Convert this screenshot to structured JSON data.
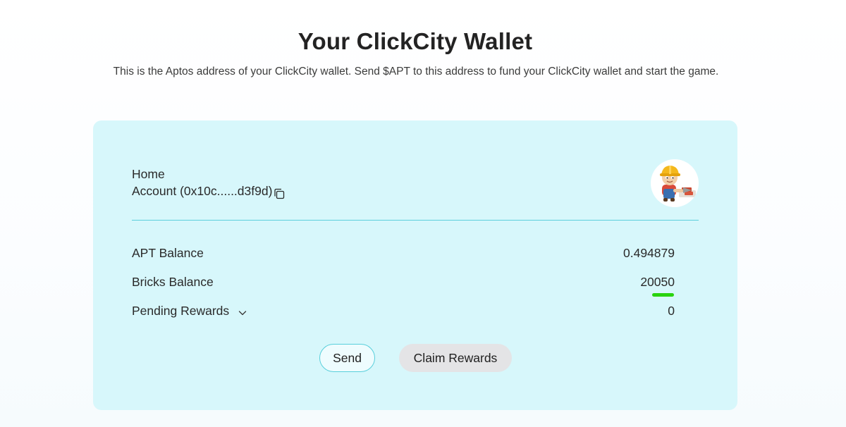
{
  "header": {
    "title": "Your ClickCity Wallet",
    "subtitle": "This is the Aptos address of your ClickCity wallet. Send $APT to this address to fund your ClickCity wallet and start the game."
  },
  "account": {
    "name": "Home",
    "label": "Account (0x10c......d3f9d)",
    "copy_icon": "copy-icon",
    "avatar_icon": "builder-character-avatar"
  },
  "balances": {
    "apt_label": "APT Balance",
    "apt_value": "0.494879",
    "bricks_label": "Bricks Balance",
    "bricks_value": "20050",
    "pending_label": "Pending Rewards",
    "pending_value": "0",
    "pending_icon": "chevron-down-icon"
  },
  "actions": {
    "send_label": "Send",
    "claim_label": "Claim Rewards"
  },
  "colors": {
    "card_background": "#d7f7fb",
    "divider": "#5ccfdc",
    "send_border": "#58cfdb",
    "claim_background": "#e4e4e6",
    "highlight": "#29d40f"
  }
}
